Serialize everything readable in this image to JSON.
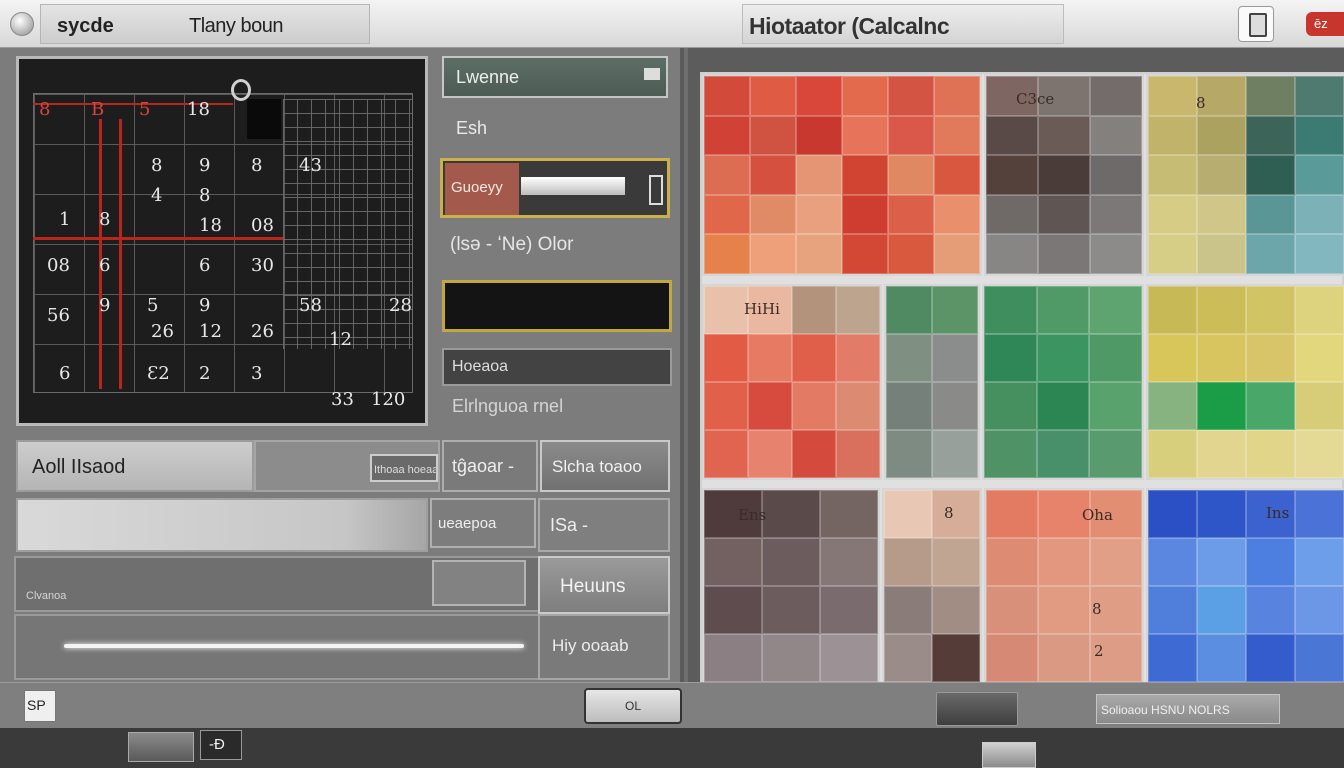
{
  "titlebar": {
    "left_title_a": "sycde",
    "left_title_b": "Tlany boun",
    "center_title": "Hiotaator (Calcalnc",
    "red_badge": "ēz"
  },
  "calendar": {
    "cells": [
      {
        "t": "8",
        "c": "red"
      },
      {
        "t": "B",
        "c": "red"
      },
      {
        "t": "5",
        "c": "red"
      },
      {
        "t": "18",
        "c": "white"
      },
      {
        "t": "8",
        "c": "white"
      },
      {
        "t": "9",
        "c": "white"
      },
      {
        "t": "8",
        "c": "white"
      },
      {
        "t": "4",
        "c": "white"
      },
      {
        "t": "8",
        "c": "white"
      },
      {
        "t": "43",
        "c": "white"
      },
      {
        "t": "1",
        "c": "white"
      },
      {
        "t": "8",
        "c": "white"
      },
      {
        "t": "18",
        "c": "white"
      },
      {
        "t": "08",
        "c": "white"
      },
      {
        "t": "08",
        "c": "white"
      },
      {
        "t": "6",
        "c": "white"
      },
      {
        "t": "6",
        "c": "white"
      },
      {
        "t": "30",
        "c": "white"
      },
      {
        "t": "9",
        "c": "white"
      },
      {
        "t": "5",
        "c": "white"
      },
      {
        "t": "9",
        "c": "white"
      },
      {
        "t": "58",
        "c": "white"
      },
      {
        "t": "28",
        "c": "white"
      },
      {
        "t": "56",
        "c": "white"
      },
      {
        "t": "26",
        "c": "white"
      },
      {
        "t": "12",
        "c": "white"
      },
      {
        "t": "26",
        "c": "white"
      },
      {
        "t": "6",
        "c": "white"
      },
      {
        "t": "Ɛ2",
        "c": "white"
      },
      {
        "t": "2",
        "c": "white"
      },
      {
        "t": "3",
        "c": "white"
      },
      {
        "t": "12",
        "c": "white"
      },
      {
        "t": "33",
        "c": "white"
      },
      {
        "t": "120",
        "c": "white"
      }
    ]
  },
  "form": {
    "name_value": "Lwenne",
    "email_label": "Esh",
    "select_value": "Guoeyy",
    "date_label": "(lsə - ʻNe) Olor",
    "search_value": "Hoeaoa",
    "hint_label": "Elrlnguoa rnel"
  },
  "rows": {
    "row1_input": "Aoll IIsaod",
    "row1_small": "Ithoaa hoeaa",
    "row1_b1": "tĝaoar -",
    "row1_b2": "Slcha toaoo",
    "row2_b1": "ueaepoa",
    "row2_b2": "ISa -",
    "row3_label": "Clvanoa",
    "row3_b": "Heuuns",
    "row4_b": "Hiy ooaab"
  },
  "palette": {
    "block_labels": [
      "",
      "C3ce",
      "8",
      "Hi",
      "",
      "",
      "",
      "Ens",
      "8",
      "Oha",
      "Ins"
    ],
    "row_labels": [
      "Hi",
      "8",
      "2"
    ]
  },
  "status": {
    "left_icon": "SP",
    "ok_label": "OL",
    "text": "Solioaou  HSNU NOLRS",
    "task_label": "-Ð"
  }
}
